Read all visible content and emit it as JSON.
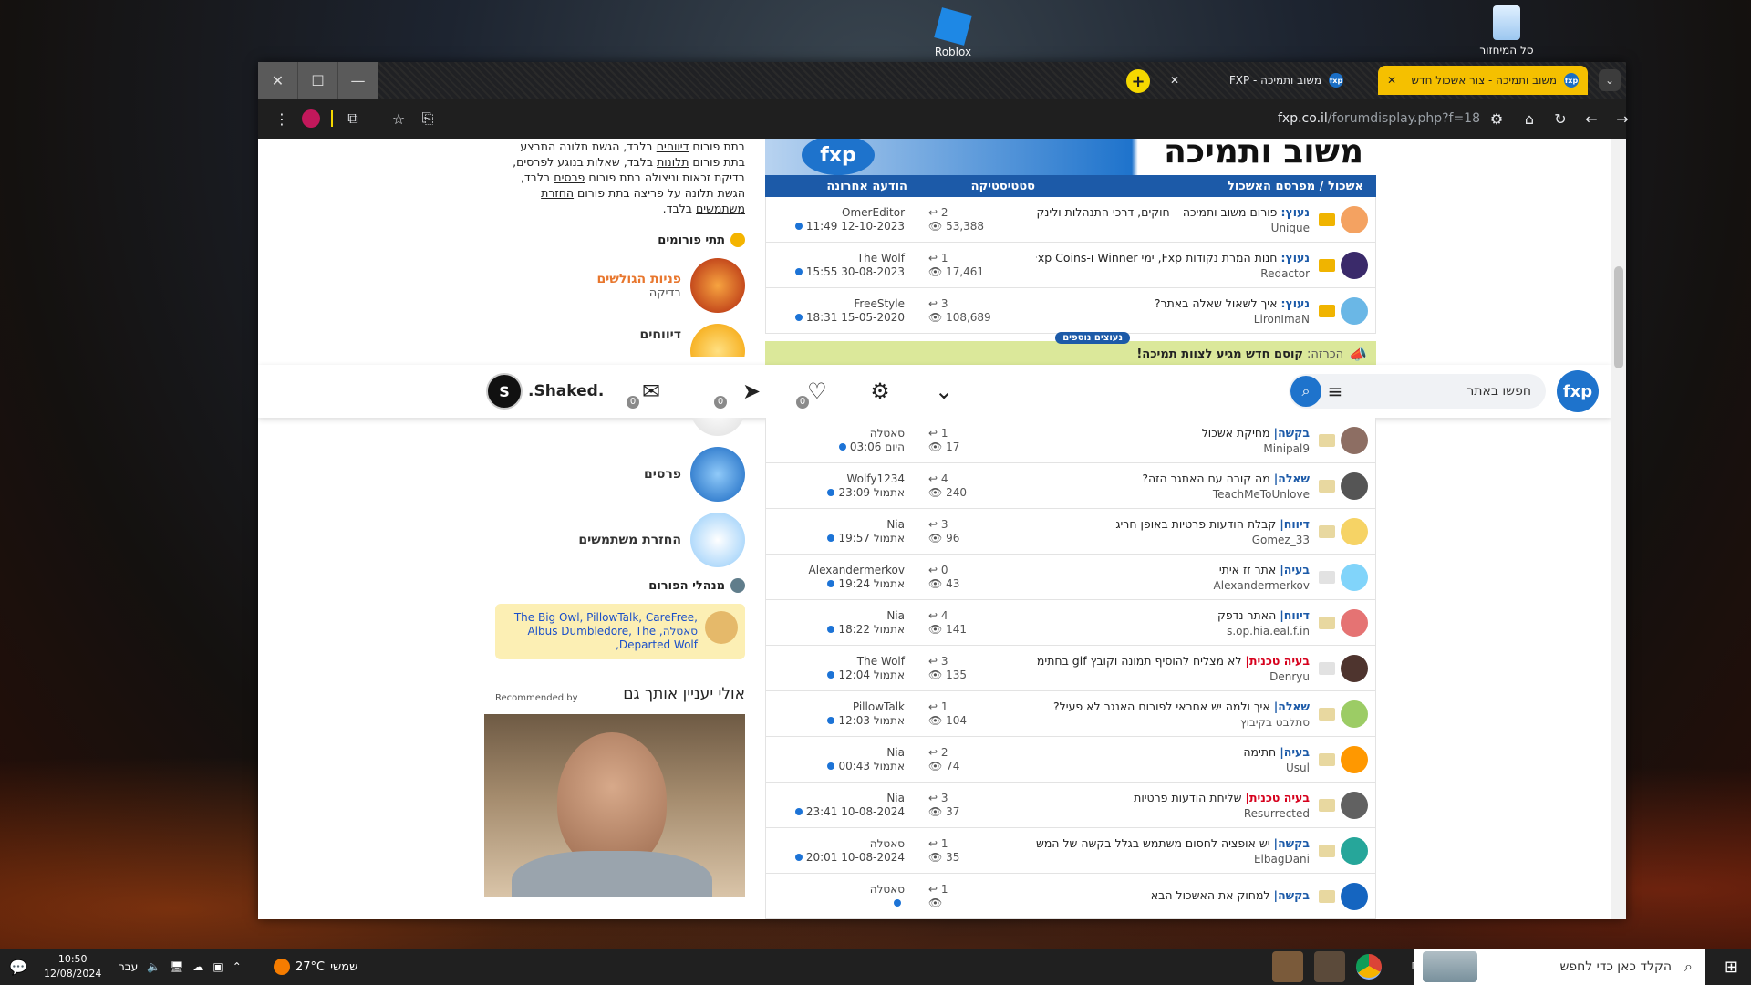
{
  "desktop": {
    "icons": [
      {
        "label": "Roblox"
      },
      {
        "label": "סל המיחזור"
      }
    ]
  },
  "browser": {
    "tabs": [
      {
        "label": "משוב ותמיכה - צור אשכול חדש",
        "active": true
      },
      {
        "label": "משוב ותמיכה - FXP",
        "active": false
      }
    ],
    "url_host": "fxp.co.il",
    "url_path": "/forumdisplay.php?f=18",
    "window_controls": {
      "close": "✕",
      "maximize": "☐",
      "minimize": "—"
    }
  },
  "sidebar": {
    "rules_lines": [
      {
        "pre": "בתת פורום ",
        "link": "דיווחים",
        "post": " בלבד, הגשת תלונה התבצע"
      },
      {
        "pre": "בתת פורום ",
        "link": "תלונות",
        "post": " בלבד, שאלות בנוגע לפרסים,"
      },
      {
        "pre": "בדיקת זכאות וניצולה בתת פורום ",
        "link": "פרסים",
        "post": " בלבד,"
      },
      {
        "pre": "הגשת תלונה על פריצה בתת פורום ",
        "link": "החזרת",
        "post": ""
      },
      {
        "pre": "",
        "link": "משתמשים",
        "post": " בלבד."
      }
    ],
    "subforums_heading": "תתי פורומים",
    "subforums": [
      {
        "name": "פניות הגולשים",
        "sub": "בדיקה",
        "orange": true,
        "color": "#c0392b"
      },
      {
        "name": "דיווחים",
        "sub": "",
        "orange": false,
        "color": "#f4b400"
      },
      {
        "name": "פרסים",
        "sub": "",
        "orange": false,
        "color": "#1e88e5"
      },
      {
        "name": "החזרת משתמשים",
        "sub": "",
        "orange": false,
        "color": "#90caf9"
      }
    ],
    "mods_heading": "מנהלי הפורום",
    "mods": "The Big Owl, PillowTalk, CareFree, Albus Dumbledore, The ,סאטלה ,Departed Wolf",
    "rec_title": "אולי יעניין אותך גם",
    "rec_by": "Recommended by"
  },
  "main": {
    "title": "משוב ותמיכה",
    "logo": "fxp",
    "col_thread": "אשכול / מפרסם האשכול",
    "col_stats": "סטטיסטיקה",
    "col_last": "הודעה אחרונה",
    "sticky": [
      {
        "prefix": "נעוץ:",
        "red": false,
        "title": "פורום משוב ותמיכה – חוקים, דרכי התנהלות ולינקייה",
        "author": "Unique",
        "replies": "2",
        "views": "53,388",
        "last_user": "OmerEditor",
        "last_date": "11:49 12-10-2023",
        "status": "lock",
        "avatar": "#f4a261"
      },
      {
        "prefix": "נעוץ:",
        "red": false,
        "title": "חנות המרת נקודות Fxp, ימי Winner ו-Fxp Coins",
        "author": "Redactor",
        "replies": "1",
        "views": "17,461",
        "last_user": "The Wolf",
        "last_date": "15:55 30-08-2023",
        "status": "lock",
        "avatar": "#3a2a6a"
      },
      {
        "prefix": "נעוץ:",
        "red": false,
        "title": "איך לשאול שאלה באתר?",
        "author": "LironImaN",
        "replies": "3",
        "views": "108,689",
        "last_user": "FreeStyle",
        "last_date": "18:31 15-05-2020",
        "status": "lock",
        "avatar": "#6ab7e6"
      }
    ],
    "more_sticky": "נעוצים נוספים",
    "announcement_label": "הכרזה:",
    "announcement": "קוסם חדש מגיע לצוות תמיכה!",
    "threads": [
      {
        "prefix": "בקשה|",
        "red": false,
        "title": "מחיקת אשכול",
        "author": "Minipal9",
        "replies": "1",
        "views": "17",
        "last_user": "סאטלה",
        "last_date": "היום 03:06",
        "status": "unread",
        "avatar": "#8d6e63"
      },
      {
        "prefix": "שאלה|",
        "red": false,
        "title": "מה קורה עם האתגר הזה?",
        "author": "TeachMeToUnlove",
        "replies": "4",
        "views": "240",
        "last_user": "Wolfy1234",
        "last_date": "אתמול 23:09",
        "status": "unread",
        "avatar": "#555"
      },
      {
        "prefix": "דיווח|",
        "red": false,
        "title": "קבלת הודעות פרטיות באופן חריג",
        "author": "Gomez_33",
        "replies": "3",
        "views": "96",
        "last_user": "Nia",
        "last_date": "אתמול 19:57",
        "status": "unread",
        "avatar": "#f6d365"
      },
      {
        "prefix": "בעיה|",
        "red": false,
        "title": "אתר זז איתי",
        "author": "Alexandermerkov",
        "replies": "0",
        "views": "43",
        "last_user": "Alexandermerkov",
        "last_date": "אתמול 19:24",
        "status": "read",
        "avatar": "#81d4fa"
      },
      {
        "prefix": "דיווח|",
        "red": false,
        "title": "האתר נדפק",
        "author": "s.op.hia.eal.f.in",
        "replies": "4",
        "views": "141",
        "last_user": "Nia",
        "last_date": "אתמול 18:22",
        "status": "unread",
        "avatar": "#e57373"
      },
      {
        "prefix": "בעיה טכנית|",
        "red": true,
        "title": "לא מצליח להוסיף תמונה וקובץ gif בחתימה",
        "author": "Denryu",
        "replies": "3",
        "views": "135",
        "last_user": "The Wolf",
        "last_date": "אתמול 12:04",
        "status": "read",
        "avatar": "#4e342e"
      },
      {
        "prefix": "שאלה|",
        "red": false,
        "title": "איך ולמה יש אחראי לפורום האנגר לא פעיל?",
        "author": "סתלבט בקיבוץ",
        "replies": "1",
        "views": "104",
        "last_user": "PillowTalk",
        "last_date": "אתמול 12:03",
        "status": "unread",
        "avatar": "#9ccc65"
      },
      {
        "prefix": "בעיה|",
        "red": false,
        "title": "חתימה",
        "author": "Usul",
        "replies": "2",
        "views": "74",
        "last_user": "Nia",
        "last_date": "אתמול 00:43",
        "status": "unread",
        "avatar": "#ff9800"
      },
      {
        "prefix": "בעיה טכנית|",
        "red": true,
        "title": "שליחת הודעות פרטיות",
        "author": "Resurrected",
        "replies": "3",
        "views": "37",
        "last_user": "Nia",
        "last_date": "23:41 10-08-2024",
        "status": "unread",
        "avatar": "#616161"
      },
      {
        "prefix": "בקשה|",
        "red": false,
        "title": "יש אופציה לחסום משתמש בגלל בקשה של המשתמש?",
        "author": "ElbagDani",
        "replies": "1",
        "views": "35",
        "last_user": "סאטלה",
        "last_date": "20:01 10-08-2024",
        "status": "unread",
        "avatar": "#26a69a"
      },
      {
        "prefix": "בקשה|",
        "red": false,
        "title": "למחוק את האשכול הבא",
        "author": "",
        "replies": "1",
        "views": "",
        "last_user": "סאטלה",
        "last_date": "",
        "status": "unread",
        "avatar": "#1565c0"
      }
    ]
  },
  "nav": {
    "search_placeholder": "חפשו באתר",
    "username": ".Shaked.",
    "avatar_letter": "S",
    "badge_likes": "0",
    "badge_msgs": "0",
    "badge_mail": "0"
  },
  "taskbar": {
    "search_placeholder": "הקלד כאן כדי לחפש",
    "weather_text": "שמשי",
    "temperature": "27°C",
    "time": "10:50",
    "date": "12/08/2024",
    "lang": "עבר"
  }
}
